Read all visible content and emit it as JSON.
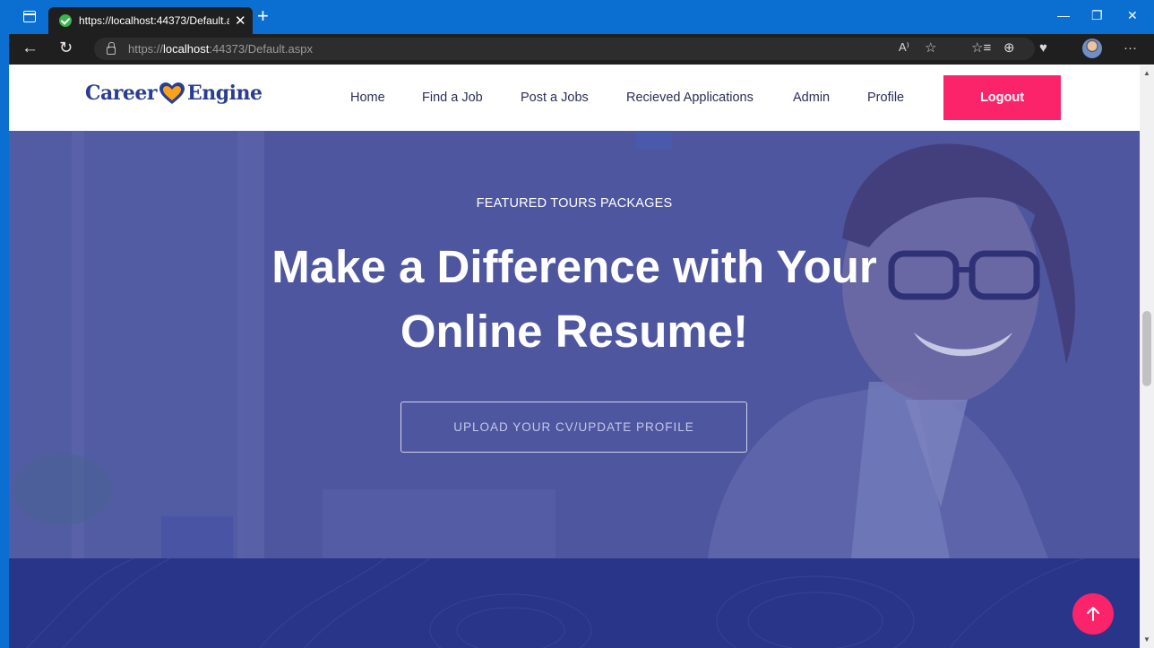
{
  "browser": {
    "tab_title": "https://localhost:44373/Default.a",
    "url_scheme": "https://",
    "url_host": "localhost",
    "url_path": ":44373/Default.aspx",
    "icons": [
      "tab-actions-icon",
      "check-favicon",
      "close-icon",
      "new-tab-icon",
      "minimize-icon",
      "restore-icon",
      "close-window-icon",
      "back-icon",
      "refresh-icon",
      "lock-icon",
      "read-aloud-icon",
      "favorite-icon",
      "favorites-icon",
      "collections-icon",
      "health-icon",
      "profile-avatar",
      "more-icon"
    ]
  },
  "site": {
    "logo": {
      "word1": "Career",
      "word2": "Engine"
    },
    "nav": [
      "Home",
      "Find a Job",
      "Post a Jobs",
      "Recieved Applications",
      "Admin",
      "Profile"
    ],
    "logout_label": "Logout"
  },
  "hero": {
    "subtitle": "FEATURED TOURS PACKAGES",
    "title_line1": "Make a Difference with Your",
    "title_line2": "Online Resume!",
    "cta_label": "UPLOAD YOUR CV/UPDATE PROFILE"
  },
  "colors": {
    "brand_blue": "#2a3e91",
    "accent_pink": "#fb246a",
    "band_navy": "#283588",
    "hero_tint": "#515a9f"
  }
}
